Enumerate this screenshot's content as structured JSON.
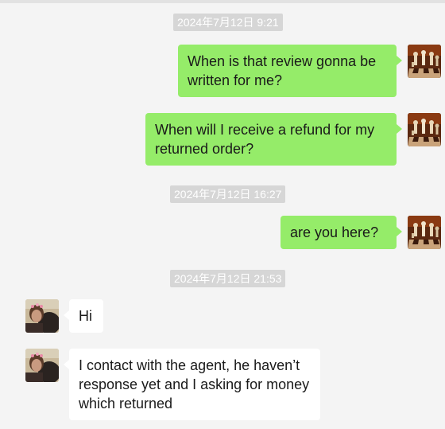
{
  "messages": [
    {
      "timestamp": "2024年7月12日 9:21"
    },
    {
      "from": "me",
      "text": "When is that review gonna be written for me?"
    },
    {
      "from": "me",
      "text": "When will I receive a refund for my returned order?"
    },
    {
      "timestamp": "2024年7月12日 16:27"
    },
    {
      "from": "me",
      "text": "are you here?"
    },
    {
      "timestamp": "2024年7月12日 21:53"
    },
    {
      "from": "other",
      "text": "Hi"
    },
    {
      "from": "other",
      "text": "I contact with the agent, he haven’t response yet and I asking for money which returned"
    }
  ],
  "avatars": {
    "me": "chess-board-avatar",
    "other": "person-photo-avatar"
  },
  "colors": {
    "background": "#f4f4f4",
    "outgoing_bubble": "#95ec69",
    "incoming_bubble": "#ffffff",
    "timestamp_bg": "#d6d6d6"
  }
}
